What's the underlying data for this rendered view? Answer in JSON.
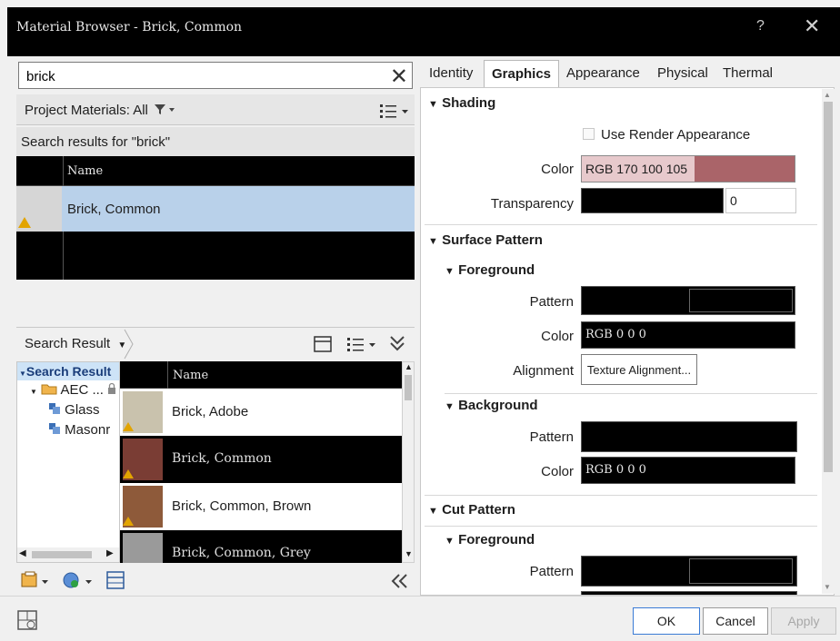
{
  "window": {
    "title": "Material Browser - Brick, Common",
    "help": "?",
    "close": "✕"
  },
  "search": {
    "value": "brick",
    "clear": "✕"
  },
  "project_bar": {
    "label": "Project Materials: All"
  },
  "results": {
    "caption": "Search results for \"brick\"",
    "header_name": "Name",
    "rows": [
      {
        "name": "Brick, Common",
        "selected": true
      }
    ]
  },
  "library_bar": {
    "label": "Search Result"
  },
  "tree": {
    "root": "Search Result",
    "items": [
      "AEC ...",
      "Glass",
      "Masonr"
    ]
  },
  "library": {
    "header_name": "Name",
    "rows": [
      {
        "name": "Brick, Adobe",
        "color": "#c9c2ad"
      },
      {
        "name": "Brick, Common",
        "color": "#7a3d34"
      },
      {
        "name": "Brick, Common, Brown",
        "color": "#8e5a3a"
      },
      {
        "name": "Brick, Common, Grey",
        "color": "#9a9a9a"
      }
    ]
  },
  "tabs": [
    {
      "label": "Identity",
      "active": false
    },
    {
      "label": "Graphics",
      "active": true
    },
    {
      "label": "Appearance",
      "active": false
    },
    {
      "label": "Physical",
      "active": false
    },
    {
      "label": "Thermal",
      "active": false
    }
  ],
  "graphics": {
    "shading": {
      "title": "Shading",
      "use_render": "Use Render Appearance",
      "color_label": "Color",
      "color_value": "RGB 170 100 105",
      "color_hex": "#aa6469",
      "transparency_label": "Transparency",
      "transparency_value": "0"
    },
    "surface": {
      "title": "Surface Pattern",
      "foreground": {
        "title": "Foreground",
        "pattern_label": "Pattern",
        "color_label": "Color",
        "color_value": "RGB 0 0 0",
        "alignment_label": "Alignment",
        "alignment_button": "Texture Alignment..."
      },
      "background": {
        "title": "Background",
        "pattern_label": "Pattern",
        "color_label": "Color",
        "color_value": "RGB 0 0 0"
      }
    },
    "cut": {
      "title": "Cut Pattern",
      "foreground": {
        "title": "Foreground",
        "pattern_label": "Pattern"
      }
    }
  },
  "footer": {
    "ok": "OK",
    "cancel": "Cancel",
    "apply": "Apply"
  }
}
